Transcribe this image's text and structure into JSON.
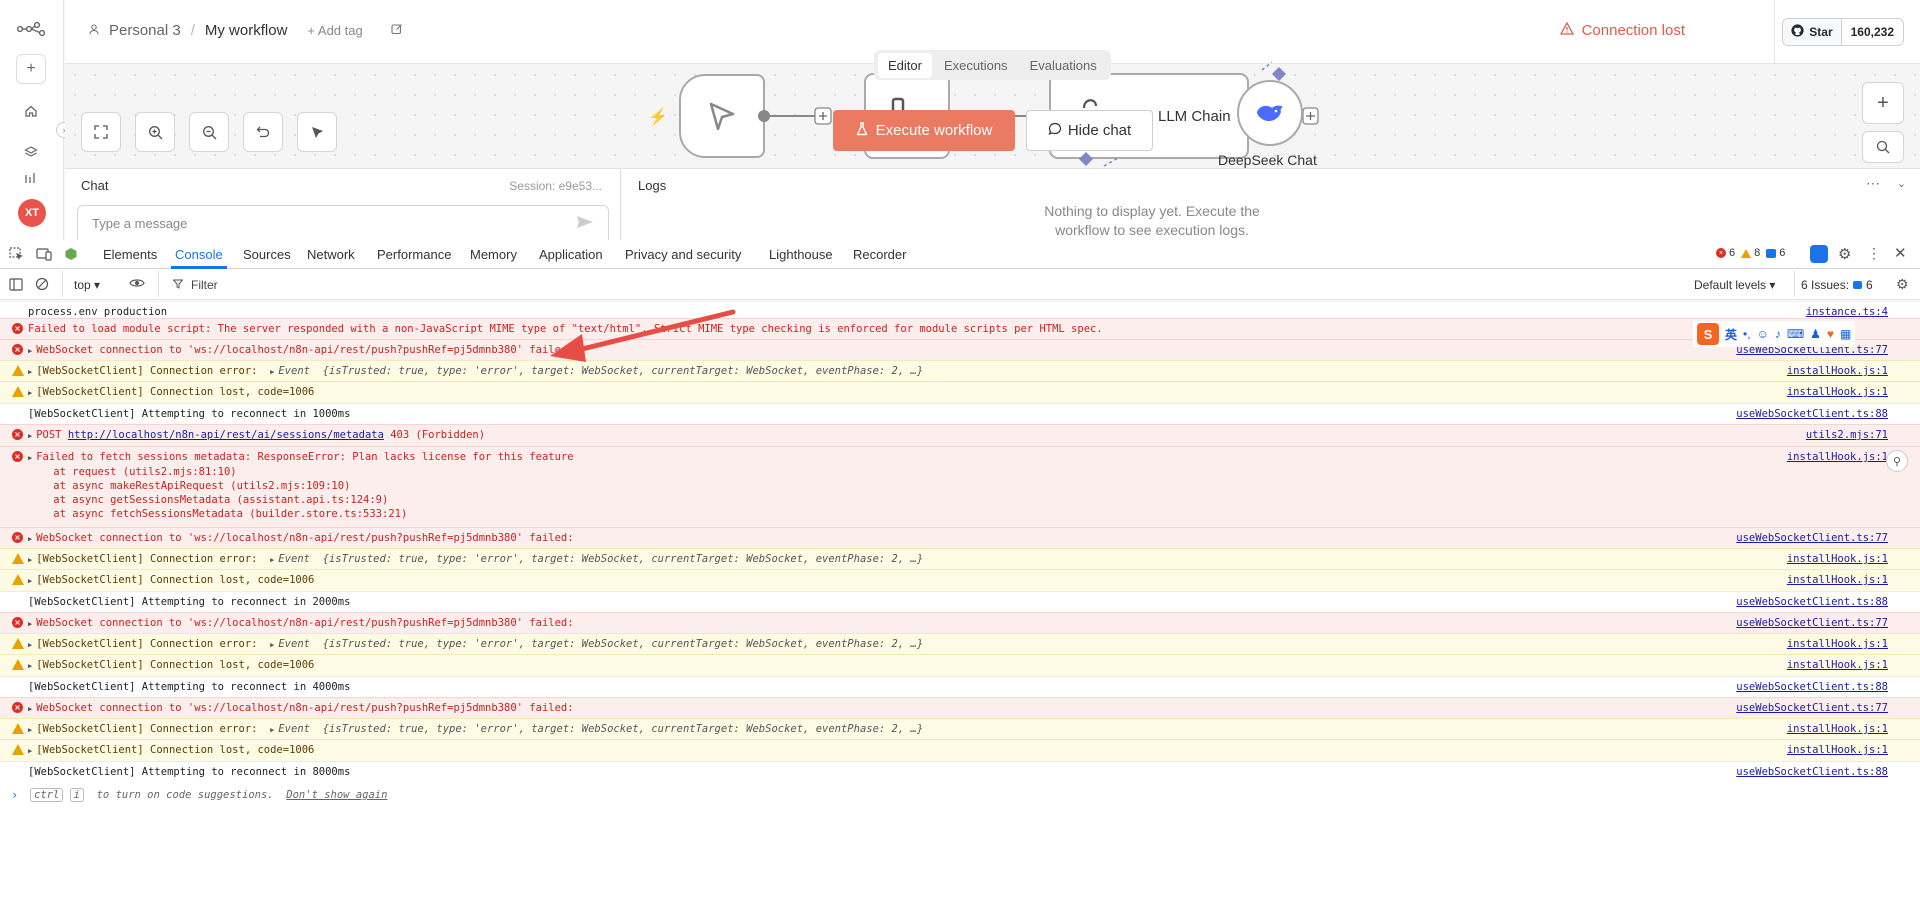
{
  "app": {
    "breadcrumb": {
      "project": "Personal 3",
      "workflow": "My workflow",
      "add_tag": "+ Add tag"
    },
    "connection_status": "Connection lost",
    "github": {
      "star_label": "Star",
      "star_count": "160,232"
    },
    "avatar_initials": "XT",
    "view_tabs": [
      "Editor",
      "Executions",
      "Evaluations"
    ],
    "active_view_tab": "Editor",
    "execute_button": "Execute workflow",
    "hide_chat_button": "Hide chat",
    "nodes": {
      "llm_chain": "LLM Chain",
      "deepseek": "DeepSeek Chat"
    },
    "chat": {
      "title": "Chat",
      "session": "Session: e9e53...",
      "input_placeholder": "Type a message"
    },
    "logs": {
      "title": "Logs",
      "empty_text": "Nothing to display yet. Execute the workflow to see execution logs."
    },
    "colors": {
      "accent": "#ea7a61",
      "error": "#e35a48"
    }
  },
  "devtools": {
    "tabs": [
      "Elements",
      "Console",
      "Sources",
      "Network",
      "Performance",
      "Memory",
      "Application",
      "Privacy and security",
      "Lighthouse",
      "Recorder"
    ],
    "active_tab": "Console",
    "counts": {
      "errors": "6",
      "warnings": "8",
      "info": "6"
    },
    "toolbar": {
      "context": "top",
      "filter": "Filter",
      "levels": "Default levels",
      "issues": "6 Issues:",
      "issues_count": "6"
    },
    "console_rows": [
      {
        "type": "info",
        "text": "process.env production",
        "source": "instance.ts:4"
      },
      {
        "type": "err",
        "text": "Failed to load module script: The server responded with a non-JavaScript MIME type of \"text/html\". Strict MIME type checking is enforced for module scripts per HTML spec.",
        "source": ""
      },
      {
        "type": "err",
        "text": "WebSocket connection to 'ws://localhost/n8n-api/rest/push?pushRef=pj5dmnb380' failed:",
        "source": "useWebSocketClient.ts:77",
        "expand": true
      },
      {
        "type": "warn",
        "text": "[WebSocketClient] Connection error:",
        "event": "Event  {isTrusted: true, type: 'error', target: WebSocket, currentTarget: WebSocket, eventPhase: 2, …}",
        "source": "installHook.js:1",
        "expand": true
      },
      {
        "type": "warn",
        "text": "[WebSocketClient] Connection lost, code=1006",
        "source": "installHook.js:1",
        "expand": true
      },
      {
        "type": "info",
        "text": "[WebSocketClient] Attempting to reconnect in 1000ms",
        "source": "useWebSocketClient.ts:88"
      },
      {
        "type": "err",
        "text": "POST ",
        "link": "http://localhost/n8n-api/rest/ai/sessions/metadata",
        "tail": " 403 (Forbidden)",
        "source": "utils2.mjs:71",
        "expand": true
      },
      {
        "type": "err",
        "text": "Failed to fetch sessions metadata: ResponseError: Plan lacks license for this feature",
        "stack": [
          "    at request (utils2.mjs:81:10)",
          "    at async makeRestApiRequest (utils2.mjs:109:10)",
          "    at async getSessionsMetadata (assistant.api.ts:124:9)",
          "    at async fetchSessionsMetadata (builder.store.ts:533:21)"
        ],
        "source": "installHook.js:1",
        "expand": true
      },
      {
        "type": "err",
        "text": "WebSocket connection to 'ws://localhost/n8n-api/rest/push?pushRef=pj5dmnb380' failed:",
        "source": "useWebSocketClient.ts:77",
        "expand": true
      },
      {
        "type": "warn",
        "text": "[WebSocketClient] Connection error:",
        "event": "Event  {isTrusted: true, type: 'error', target: WebSocket, currentTarget: WebSocket, eventPhase: 2, …}",
        "source": "installHook.js:1",
        "expand": true
      },
      {
        "type": "warn",
        "text": "[WebSocketClient] Connection lost, code=1006",
        "source": "installHook.js:1",
        "expand": true
      },
      {
        "type": "info",
        "text": "[WebSocketClient] Attempting to reconnect in 2000ms",
        "source": "useWebSocketClient.ts:88"
      },
      {
        "type": "err",
        "text": "WebSocket connection to 'ws://localhost/n8n-api/rest/push?pushRef=pj5dmnb380' failed:",
        "source": "useWebSocketClient.ts:77",
        "expand": true
      },
      {
        "type": "warn",
        "text": "[WebSocketClient] Connection error:",
        "event": "Event  {isTrusted: true, type: 'error', target: WebSocket, currentTarget: WebSocket, eventPhase: 2, …}",
        "source": "installHook.js:1",
        "expand": true
      },
      {
        "type": "warn",
        "text": "[WebSocketClient] Connection lost, code=1006",
        "source": "installHook.js:1",
        "expand": true
      },
      {
        "type": "info",
        "text": "[WebSocketClient] Attempting to reconnect in 4000ms",
        "source": "useWebSocketClient.ts:88"
      },
      {
        "type": "err",
        "text": "WebSocket connection to 'ws://localhost/n8n-api/rest/push?pushRef=pj5dmnb380' failed:",
        "source": "useWebSocketClient.ts:77",
        "expand": true
      },
      {
        "type": "warn",
        "text": "[WebSocketClient] Connection error:",
        "event": "Event  {isTrusted: true, type: 'error', target: WebSocket, currentTarget: WebSocket, eventPhase: 2, …}",
        "source": "installHook.js:1",
        "expand": true
      },
      {
        "type": "warn",
        "text": "[WebSocketClient] Connection lost, code=1006",
        "source": "installHook.js:1",
        "expand": true
      },
      {
        "type": "info",
        "text": "[WebSocketClient] Attempting to reconnect in 8000ms",
        "source": "useWebSocketClient.ts:88"
      }
    ],
    "prompt_hint": {
      "key1": "ctrl",
      "key2": "i",
      "text": "to turn on code suggestions.",
      "dismiss": "Don't show again"
    },
    "ime_label": "英"
  }
}
